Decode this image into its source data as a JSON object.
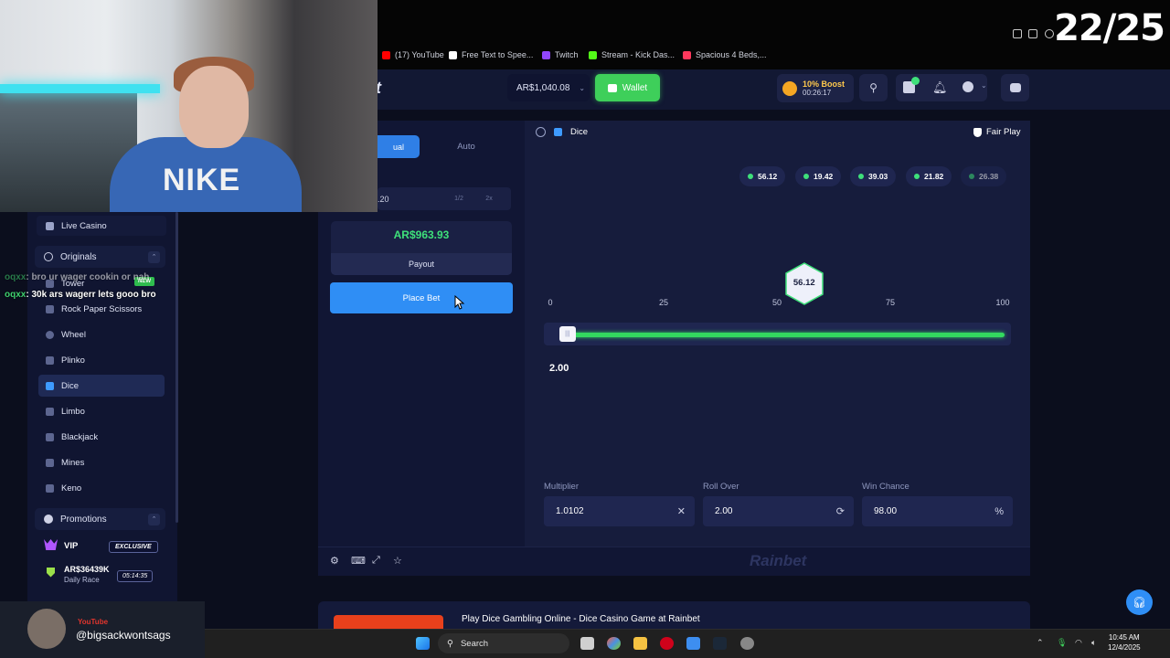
{
  "counter": "22/25",
  "bookmarks": [
    {
      "label": "(17) YouTube",
      "color": "#ff0000"
    },
    {
      "label": "Free Text to Spee...",
      "color": "#ffffff"
    },
    {
      "label": "Twitch",
      "color": "#9146ff"
    },
    {
      "label": "Stream - Kick Das...",
      "color": "#53fc18"
    },
    {
      "label": "Spacious 4 Beds,...",
      "color": "#ff385c"
    }
  ],
  "header": {
    "logo_fragment": "t",
    "balance": "AR$1,040.08",
    "wallet_label": "Wallet",
    "boost_title": "10% Boost",
    "boost_timer": "00:26:17",
    "icons": [
      "search-icon",
      "gift-icon",
      "bell-icon",
      "user-icon",
      "chat-icon"
    ]
  },
  "chat": [
    {
      "user": "oqxx",
      "message": ": bro ur wager cookin or nah"
    },
    {
      "user": "oqxx",
      "message": ": 30k ars wagerr lets gooo bro"
    }
  ],
  "sidebar": {
    "live_casino": "Live Casino",
    "originals_label": "Originals",
    "new_badge": "NEW",
    "items": [
      "Tower",
      "Rock Paper Scissors",
      "Wheel",
      "Plinko",
      "Dice",
      "Limbo",
      "Blackjack",
      "Mines",
      "Keno"
    ],
    "active": "Dice",
    "promotions_label": "Promotions",
    "vip_label": "VIP",
    "exclusive_badge": "EXCLUSIVE",
    "race_amount": "AR$36439K",
    "race_label": "Daily Race",
    "race_timer": "05:14:35"
  },
  "bet_panel": {
    "tab_manual": "ual",
    "tab_auto": "Auto",
    "bet_amount": ".20",
    "half_label": "1/2",
    "double_label": "2x",
    "payout_value": "AR$963.93",
    "payout_label": "Payout",
    "place_bet_label": "Place Bet"
  },
  "game": {
    "title": "Dice",
    "fair_play": "Fair Play",
    "recent_results": [
      "56.12",
      "19.42",
      "39.03",
      "21.82",
      "26.38"
    ],
    "scale_labels": [
      "0",
      "25",
      "50",
      "75",
      "100"
    ],
    "result_value": "56.12",
    "result_position": 56.12,
    "roll_over_position": 2.0,
    "under_value": "2.00",
    "multiplier_label": "Multiplier",
    "multiplier_value": "1.0102",
    "roll_over_label": "Roll Over",
    "roll_over_value": "2.00",
    "win_chance_label": "Win Chance",
    "win_chance_value": "98.00",
    "percent_suffix": "%",
    "brand": "Rainbet"
  },
  "page": {
    "seo_title": "Play Dice Gambling Online - Dice Casino Game at Rainbet"
  },
  "taskbar": {
    "search_label": "Search",
    "time": "10:45 AM",
    "date": "12/4/2025"
  },
  "streamer": {
    "platform": "YouTube",
    "handle": "@bigsackwontsags"
  },
  "colors": {
    "accent_blue": "#2f8ef5",
    "accent_green": "#33d95f",
    "panel": "#161c3c"
  }
}
